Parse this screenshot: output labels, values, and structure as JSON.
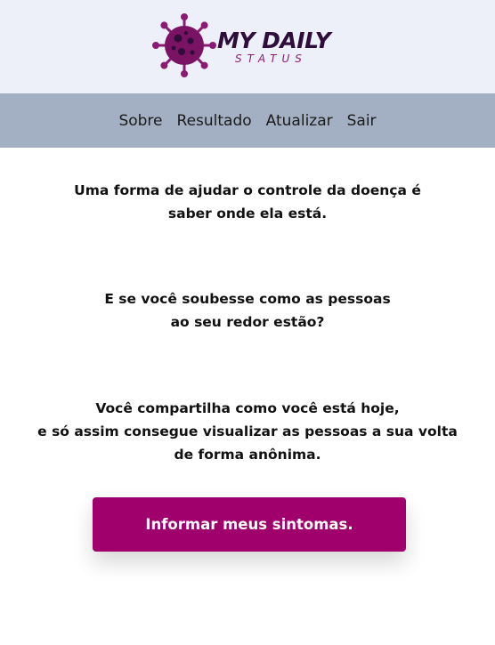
{
  "header": {
    "logo": {
      "title": "MY DAILY",
      "subtitle": "STATUS",
      "icon": "virus-icon"
    }
  },
  "nav": {
    "items": [
      {
        "label": "Sobre"
      },
      {
        "label": "Resultado"
      },
      {
        "label": "Atualizar"
      },
      {
        "label": "Sair"
      }
    ]
  },
  "main": {
    "paragraphs": [
      {
        "lines": [
          "Uma forma de ajudar o controle da doença é",
          "saber onde ela está."
        ]
      },
      {
        "lines": [
          "E se você soubesse como as pessoas",
          "ao seu redor estão?"
        ]
      },
      {
        "lines": [
          "Você compartilha como você está hoje,",
          "e só assim consegue visualizar as pessoas a sua volta",
          "de forma anônima."
        ]
      }
    ],
    "cta_label": "Informar meus sintomas."
  },
  "colors": {
    "header_bg": "#eef0f9",
    "nav_bg": "#a3afc2",
    "brand_primary": "#a0006c",
    "logo_dark": "#2e0d3b",
    "logo_accent": "#8b1a72"
  }
}
